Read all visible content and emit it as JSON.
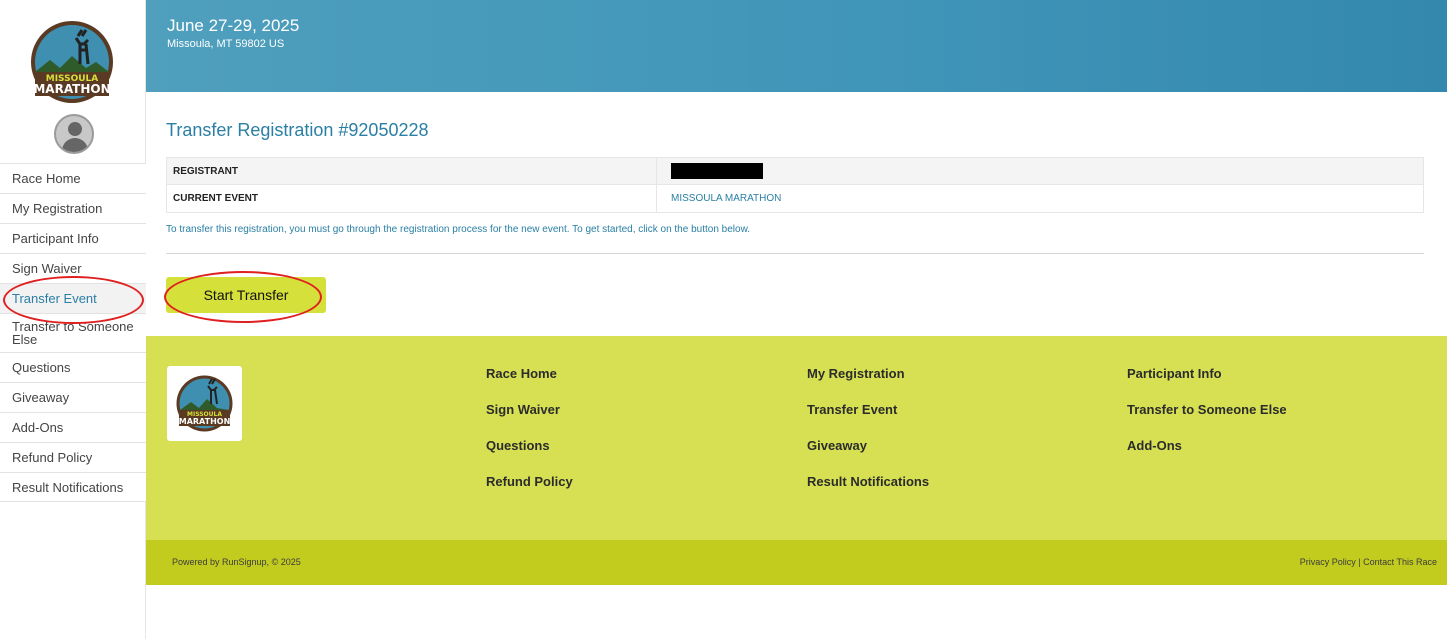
{
  "brand": {
    "logo_icon": "missoula-marathon-elk-logo-icon",
    "accent_color": "#d6e03a",
    "header_color": "#3f95b8",
    "link_color": "#2a7fa4"
  },
  "header": {
    "date": "June 27-29, 2025",
    "location": "Missoula, MT 59802 US"
  },
  "sidebar": {
    "items": [
      {
        "label": "Race Home"
      },
      {
        "label": "My Registration"
      },
      {
        "label": "Participant Info"
      },
      {
        "label": "Sign Waiver"
      },
      {
        "label": "Transfer Event"
      },
      {
        "label": "Transfer to Someone Else"
      },
      {
        "label": "Questions"
      },
      {
        "label": "Giveaway"
      },
      {
        "label": "Add-Ons"
      },
      {
        "label": "Refund Policy"
      },
      {
        "label": "Result Notifications"
      }
    ],
    "active_index": 4
  },
  "main": {
    "title": "Transfer Registration #92050228",
    "table": [
      {
        "label": "REGISTRANT",
        "value": ""
      },
      {
        "label": "CURRENT EVENT",
        "value": "MISSOULA MARATHON"
      }
    ],
    "note": "To transfer this registration, you must go through the registration process for the new event. To get started, click on the button below.",
    "start_button": "Start Transfer"
  },
  "footer": {
    "columns": [
      [
        "Race Home",
        "Sign Waiver",
        "Questions",
        "Refund Policy"
      ],
      [
        "My Registration",
        "Transfer Event",
        "Giveaway",
        "Result Notifications"
      ],
      [
        "Participant Info",
        "Transfer to Someone Else",
        "Add-Ons"
      ]
    ],
    "powered_by": "Powered by RunSignup, © 2025",
    "privacy": "Privacy Policy",
    "separator": " | ",
    "contact": "Contact This Race"
  }
}
